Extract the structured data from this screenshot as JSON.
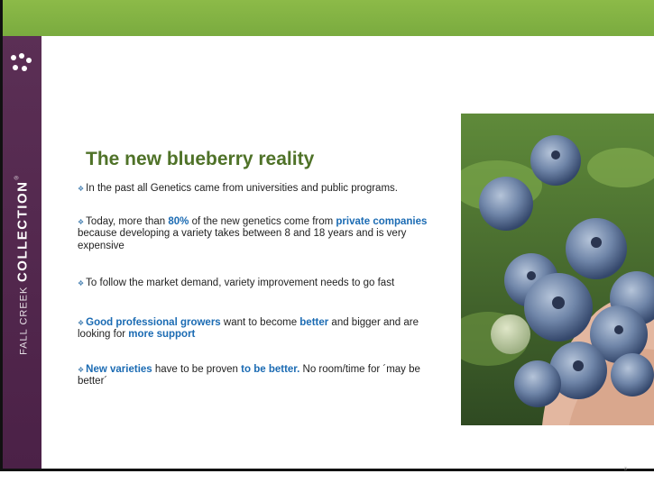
{
  "brand": {
    "light": "FALL CREEK",
    "bold": "COLLECTION",
    "mark": "®"
  },
  "title": "The new blueberry reality",
  "bullet_marker": "❖",
  "bullets": [
    {
      "text": "In the past all Genetics came from universities and public programs."
    },
    {
      "pre": "Today, more than ",
      "h1": "80%",
      "mid1": " of the new genetics come from  ",
      "h2": "private companies",
      "post": " because developing a variety takes between 8 and 18 years and is very expensive"
    },
    {
      "text": "To follow the market demand, variety improvement needs to go fast"
    },
    {
      "h1": "Good professional growers",
      "mid1": " want to become ",
      "h2": "better",
      "mid2": " and bigger and are looking for ",
      "h3": "more support"
    },
    {
      "h1": "New varieties",
      "mid1": " have to be proven ",
      "h2": "to be better.",
      "post": " No room/time for ´may be better´"
    }
  ],
  "page_number": "3",
  "colors": {
    "green_band": "#7aab3f",
    "purple_sidebar": "#4b2147",
    "title_green": "#4f7228",
    "highlight_blue": "#1b6bb3"
  },
  "image": {
    "subject": "handful of blueberries"
  }
}
